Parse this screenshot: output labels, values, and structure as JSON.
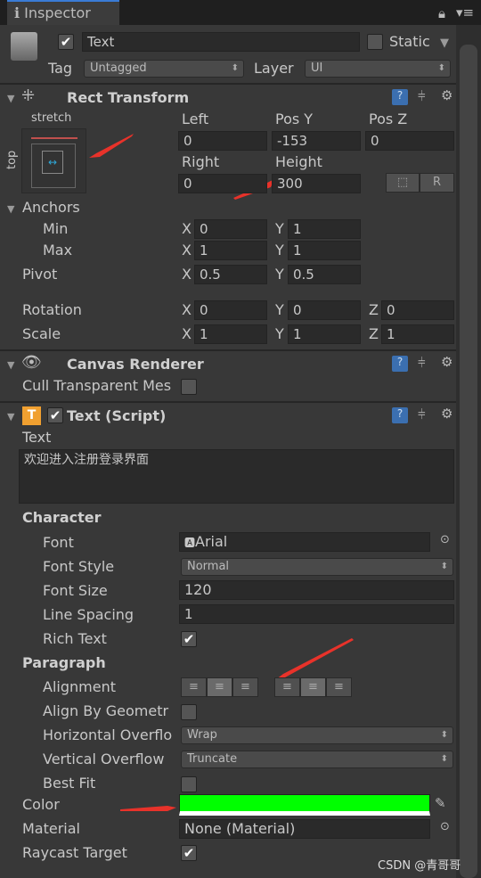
{
  "tab": {
    "title": "Inspector"
  },
  "object": {
    "active": true,
    "name": "Text",
    "static_label": "Static",
    "static": false,
    "tag_label": "Tag",
    "tag": "Untagged",
    "layer_label": "Layer",
    "layer": "UI"
  },
  "rect_transform": {
    "title": "Rect Transform",
    "anchor_h": "stretch",
    "anchor_v": "top",
    "left_label": "Left",
    "left": "0",
    "posy_label": "Pos Y",
    "posy": "-153",
    "posz_label": "Pos Z",
    "posz": "0",
    "right_label": "Right",
    "right": "0",
    "height_label": "Height",
    "height": "300",
    "r_button": "R",
    "anchors": "Anchors",
    "min": "Min",
    "max": "Max",
    "pivot": "Pivot",
    "rotation": "Rotation",
    "scale": "Scale",
    "x": "X",
    "y": "Y",
    "z": "Z",
    "min_x": "0",
    "min_y": "1",
    "max_x": "1",
    "max_y": "1",
    "pivot_x": "0.5",
    "pivot_y": "0.5",
    "rot_x": "0",
    "rot_y": "0",
    "rot_z": "0",
    "scale_x": "1",
    "scale_y": "1",
    "scale_z": "1"
  },
  "canvas_renderer": {
    "title": "Canvas Renderer",
    "cull_label": "Cull Transparent Mes",
    "cull": false
  },
  "text_script": {
    "title": "Text (Script)",
    "enabled": true,
    "text_label": "Text",
    "text": "欢迎进入注册登录界面",
    "character": "Character",
    "font_label": "Font",
    "font": "Arial",
    "font_style_label": "Font Style",
    "font_style": "Normal",
    "font_size_label": "Font Size",
    "font_size": "120",
    "line_spacing_label": "Line Spacing",
    "line_spacing": "1",
    "rich_text_label": "Rich Text",
    "rich_text": true,
    "paragraph": "Paragraph",
    "alignment_label": "Alignment",
    "alignment_h": "center",
    "alignment_v": "middle",
    "align_geom_label": "Align By Geometr",
    "align_geom": false,
    "h_overflow_label": "Horizontal Overflo",
    "h_overflow": "Wrap",
    "v_overflow_label": "Vertical Overflow",
    "v_overflow": "Truncate",
    "best_fit_label": "Best Fit",
    "best_fit": false,
    "color_label": "Color",
    "color": "#00ff00",
    "material_label": "Material",
    "material": "None (Material)",
    "raycast_label": "Raycast Target",
    "raycast": true
  },
  "watermark": "CSDN @青哥哥"
}
